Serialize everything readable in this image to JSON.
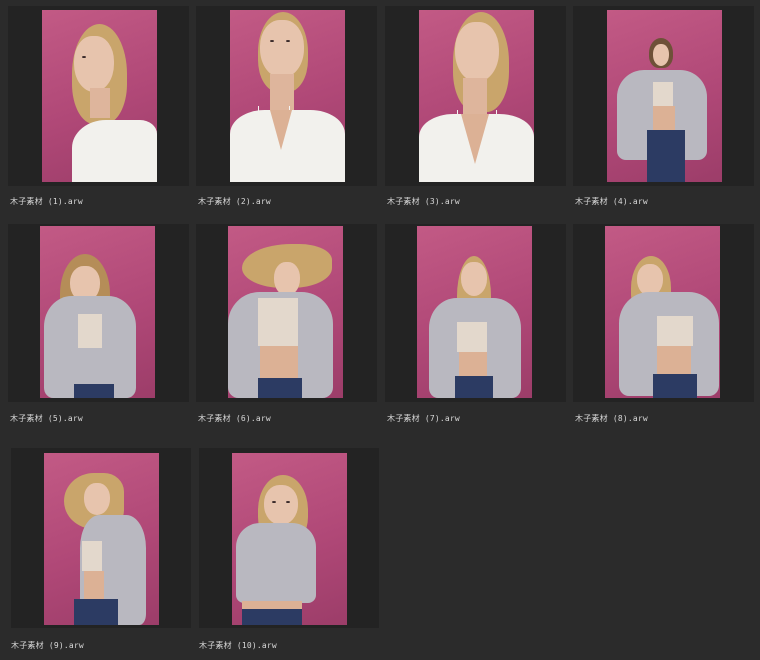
{
  "thumbnails": [
    {
      "caption": "木子素材 (1).arw",
      "shot": "headshot-profile"
    },
    {
      "caption": "木子素材 (2).arw",
      "shot": "headshot-up"
    },
    {
      "caption": "木子素材 (3).arw",
      "shot": "headshot-tilt"
    },
    {
      "caption": "木子素材 (4).arw",
      "shot": "full-fur-wide"
    },
    {
      "caption": "木子素材 (5).arw",
      "shot": "fur-front"
    },
    {
      "caption": "木子素材 (6).arw",
      "shot": "fur-hair-flip"
    },
    {
      "caption": "木子素材 (7).arw",
      "shot": "fur-front"
    },
    {
      "caption": "木子素材 (8).arw",
      "shot": "fur-head-down"
    },
    {
      "caption": "木子素材 (9).arw",
      "shot": "fur-side"
    },
    {
      "caption": "木子素材 (10).arw",
      "shot": "fur-crop"
    }
  ],
  "colors": {
    "background": "#2b2b2b",
    "frame": "#232323",
    "backdrop": "#b04877",
    "caption_text": "#d8d8d8"
  }
}
